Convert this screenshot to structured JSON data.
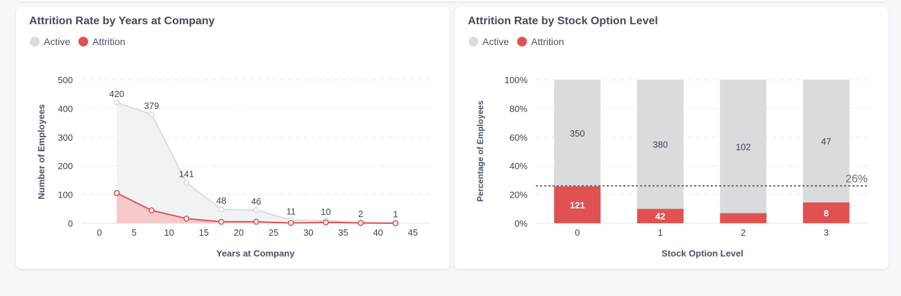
{
  "colors": {
    "active": "#d9dbdd",
    "attrition": "#e05252",
    "active_fill": "#f1f2f3",
    "attrition_fill": "#f8c9cb",
    "text": "#3b4252"
  },
  "legend": {
    "active_label": "Active",
    "attrition_label": "Attrition"
  },
  "chart_data": [
    {
      "type": "area",
      "title": "Attrition Rate by Years at Company",
      "xlabel": "Years at Company",
      "ylabel": "Number of Employees",
      "xlim": [
        -2.5,
        47.5
      ],
      "ylim": [
        0,
        500
      ],
      "xticks": [
        0,
        5,
        10,
        15,
        20,
        25,
        30,
        35,
        40,
        45
      ],
      "yticks": [
        0,
        100,
        200,
        300,
        400,
        500
      ],
      "grid": true,
      "legend_position": "top-left",
      "x": [
        2.5,
        7.5,
        12.5,
        17.5,
        22.5,
        27.5,
        32.5,
        37.5,
        42.5
      ],
      "series": [
        {
          "name": "Active",
          "values": [
            420,
            379,
            141,
            48,
            46,
            11,
            10,
            2,
            1
          ],
          "labels": [
            "420",
            "379",
            "141",
            "48",
            "46",
            "11",
            "10",
            "2",
            "1"
          ]
        },
        {
          "name": "Attrition",
          "values": [
            105,
            45,
            16,
            5,
            5,
            1,
            3,
            1,
            0
          ]
        }
      ]
    },
    {
      "type": "bar",
      "stacked": true,
      "title": "Attrition Rate by Stock Option Level",
      "xlabel": "Stock Option Level",
      "ylabel": "Percentage of Employees",
      "categories": [
        "0",
        "1",
        "2",
        "3"
      ],
      "ylim": [
        0,
        100
      ],
      "yticks": [
        "0%",
        "20%",
        "40%",
        "60%",
        "80%",
        "100%"
      ],
      "grid": true,
      "legend_position": "top-left",
      "series": [
        {
          "name": "Attrition",
          "values": [
            25.7,
            10.0,
            7.0,
            14.5
          ],
          "labels": [
            "121",
            "42",
            "",
            "8"
          ]
        },
        {
          "name": "Active",
          "values": [
            74.3,
            90.0,
            93.0,
            85.5
          ],
          "labels": [
            "350",
            "380",
            "102",
            "47"
          ]
        }
      ],
      "reference_line": {
        "value": 26,
        "label": "26%"
      }
    }
  ]
}
